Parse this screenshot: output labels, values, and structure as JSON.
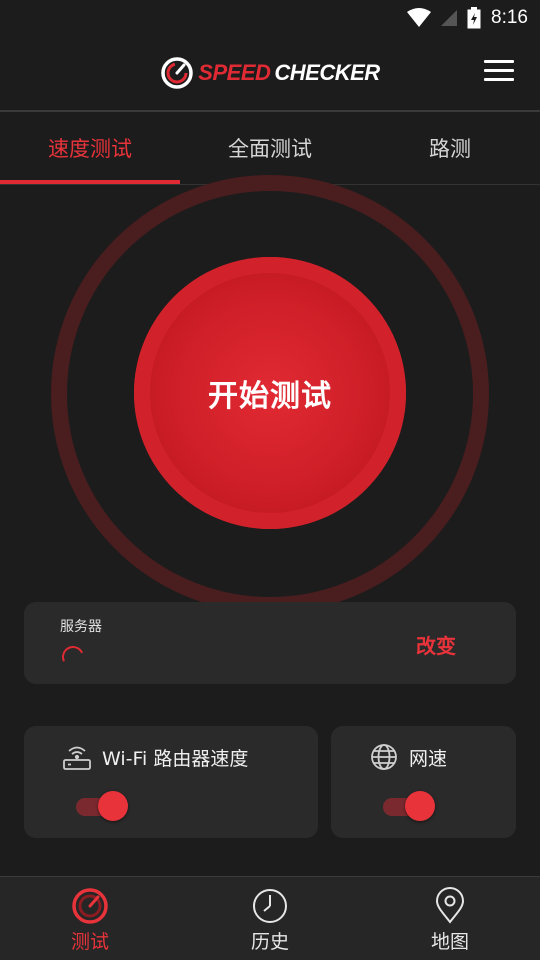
{
  "status_bar": {
    "time": "8:16",
    "icons": [
      "wifi-icon",
      "signal-icon",
      "battery-icon"
    ]
  },
  "header": {
    "logo_part1": "SPEED",
    "logo_part2": "CHECKER",
    "menu_icon": "hamburger-menu-icon"
  },
  "tabs": [
    {
      "label": "速度测试",
      "active": true
    },
    {
      "label": "全面测试",
      "active": false
    },
    {
      "label": "路测",
      "active": false
    }
  ],
  "start_button": {
    "label": "开始测试"
  },
  "server": {
    "label": "服务器",
    "change_label": "改变"
  },
  "options": {
    "wifi": {
      "label": "Wi-Fi 路由器速度",
      "icon": "router-icon",
      "enabled": true
    },
    "net": {
      "label": "网速",
      "icon": "globe-icon",
      "enabled": true
    }
  },
  "bottom_nav": [
    {
      "label": "测试",
      "icon": "speedometer-icon",
      "active": true
    },
    {
      "label": "历史",
      "icon": "clock-icon",
      "active": false
    },
    {
      "label": "地图",
      "icon": "map-pin-icon",
      "active": false
    }
  ],
  "colors": {
    "accent": "#e02a33",
    "background": "#1c1c1c",
    "card": "#2a2a2a"
  }
}
